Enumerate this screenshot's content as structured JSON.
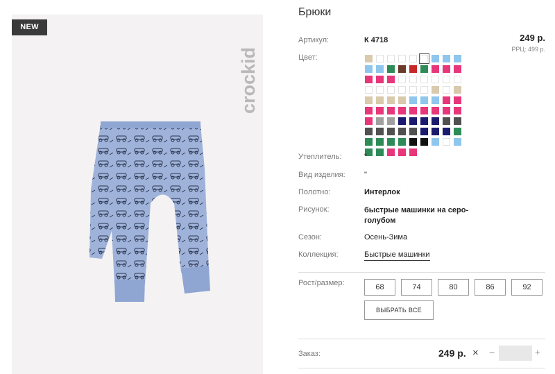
{
  "badge": "NEW",
  "brand": "crockid",
  "product": {
    "title": "Брюки",
    "article_label": "Артикул:",
    "article": "К 4718",
    "price": "249 р.",
    "rrp": "РРЦ: 499 р.",
    "color_label": "Цвет:",
    "insulation_label": "Утеплитель:",
    "insulation": "\"",
    "type_label": "Вид изделия:",
    "type": "\"",
    "fabric_label": "Полотно:",
    "fabric": "Интерлок",
    "pattern_label": "Рисунок:",
    "pattern": "быстрые машинки на серо-голубом",
    "season_label": "Сезон:",
    "season": "Осень-Зима",
    "collection_label": "Коллекция:",
    "collection": "Быстрые машинки"
  },
  "colors": [
    "#d9c9ad",
    "#ffffff",
    "#ffffff",
    "#ffffff",
    "#ffffff",
    "#ffffff",
    "#8ec6ee",
    "#8ec6ee",
    "#8ec6ee",
    "#8ec6ee",
    "#8ec6ee",
    "#2e8b57",
    "#6b3b2a",
    "#c62828",
    "#2e8b57",
    "#e8367a",
    "#e8367a",
    "#e8367a",
    "#e8367a",
    "#e8367a",
    "#e8367a",
    "#ffffff",
    "#ffffff",
    "#ffffff",
    "#ffffff",
    "#ffffff",
    "#ffffff",
    "#ffffff",
    "#ffffff",
    "#ffffff",
    "#ffffff",
    "#ffffff",
    "#ffffff",
    "#d9c9ad",
    "#ffffff",
    "#d9c9ad",
    "#d9c9ad",
    "#d9c9ad",
    "#d9c9ad",
    "#d9c9ad",
    "#8ec6ee",
    "#8ec6ee",
    "#8ec6ee",
    "#e8367a",
    "#e8367a",
    "#e8367a",
    "#e8367a",
    "#e8367a",
    "#e8367a",
    "#e8367a",
    "#e8367a",
    "#e8367a",
    "#e8367a",
    "#e8367a",
    "#e8367a",
    "#a0a0a0",
    "#a0a0a0",
    "#1a1a6e",
    "#1a1a6e",
    "#1a1a6e",
    "#1a1a6e",
    "#505050",
    "#505050",
    "#505050",
    "#505050",
    "#505050",
    "#505050",
    "#505050",
    "#1a1a6e",
    "#1a1a6e",
    "#1a1a6e",
    "#2e8b57",
    "#2e8b57",
    "#2e8b57",
    "#2e8b57",
    "#2e8b57",
    "#111111",
    "#111111",
    "#8ec6ee",
    "#ffffff",
    "#8ec6ee",
    "#2e8b57",
    "#2e8b57",
    "#e8367a",
    "#e8367a",
    "#e8367a"
  ],
  "selected_color_index": 5,
  "sizes_label": "Рост/размер:",
  "sizes": [
    "68",
    "74",
    "80",
    "86",
    "92"
  ],
  "select_all": "ВЫБРАТЬ ВСЕ",
  "order": {
    "label": "Заказ:",
    "price": "249 р.",
    "times": "×",
    "minus": "−",
    "plus": "+"
  }
}
